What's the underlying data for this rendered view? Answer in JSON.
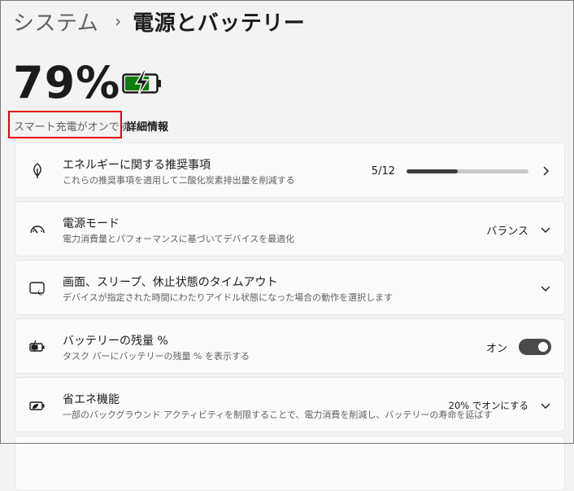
{
  "breadcrumb": {
    "parent": "システム",
    "separator": "›",
    "current": "電源とバッテリー"
  },
  "battery": {
    "percent_text": "79%",
    "level": 0.79,
    "status_color": "#107c10"
  },
  "smart_charge": {
    "text": "スマート充電がオンです。",
    "detail_link": "詳細情報"
  },
  "cards": {
    "energy": {
      "icon": "leaf-icon",
      "title": "エネルギーに関する推奨事項",
      "desc": "これらの推奨事項を適用して二酸化炭素排出量を削減する",
      "progress_text": "5/12",
      "progress_value": 0.4167
    },
    "power_mode": {
      "icon": "speedometer-icon",
      "title": "電源モード",
      "desc": "電力消費量とパフォーマンスに基づいてデバイスを最適化",
      "value": "バランス"
    },
    "screen_sleep": {
      "icon": "sleep-screen-icon",
      "title": "画面、スリープ、休止状態のタイムアウト",
      "desc": "デバイスが指定された時間にわたりアイドル状態になった場合の動作を選択します"
    },
    "battery_percent": {
      "icon": "battery-charging-icon",
      "title": "バッテリーの残量 %",
      "desc": "タスク バーにバッテリーの残量 % を表示する",
      "toggle_label": "オン",
      "toggle_on": true
    },
    "energy_saver": {
      "icon": "energy-saver-icon",
      "title": "省エネ機能",
      "desc": "一部のバックグラウンド アクティビティを制限することで、電力消費を削減し、バッテリーの寿命を延ばす",
      "value": "20% でオンにする"
    }
  }
}
